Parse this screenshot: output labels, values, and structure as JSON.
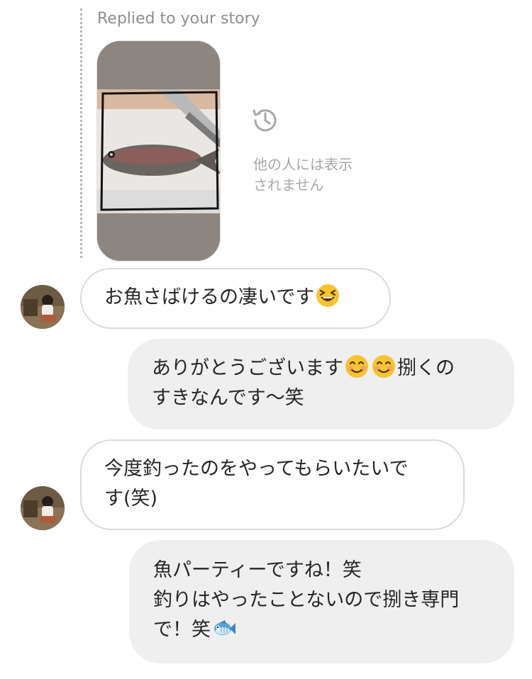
{
  "story_reply": {
    "caption": "Replied to your story",
    "expired_note_lines": [
      "他の人には表示",
      "されません"
    ],
    "expired_icon": "history-icon"
  },
  "messages": [
    {
      "direction": "incoming",
      "lines": [
        {
          "text": "お魚さばけるの凄いです",
          "emoji": "laughing-face-emoji"
        }
      ]
    },
    {
      "direction": "outgoing",
      "lines": [
        {
          "text": "ありがとうございます",
          "emojis": [
            "smiling-face-emoji",
            "smiling-face-emoji"
          ],
          "after": "捌くの"
        },
        {
          "text": "すきなんです〜笑"
        }
      ]
    },
    {
      "direction": "incoming",
      "lines": [
        {
          "text": "今度釣ったのをやってもらいたいで"
        },
        {
          "text": "す(笑)"
        }
      ]
    },
    {
      "direction": "outgoing",
      "lines": [
        {
          "text": "魚パーティーですね！笑"
        },
        {
          "text": "釣りはやったことないので捌き専門"
        },
        {
          "text": "で！笑",
          "emoji": "fish-emoji"
        }
      ]
    }
  ],
  "colors": {
    "incoming_bubble_border": "#dbdbdb",
    "outgoing_bubble_bg": "#efefef",
    "caption_gray": "#8e8e8e",
    "story_bg": "#8c8580"
  }
}
